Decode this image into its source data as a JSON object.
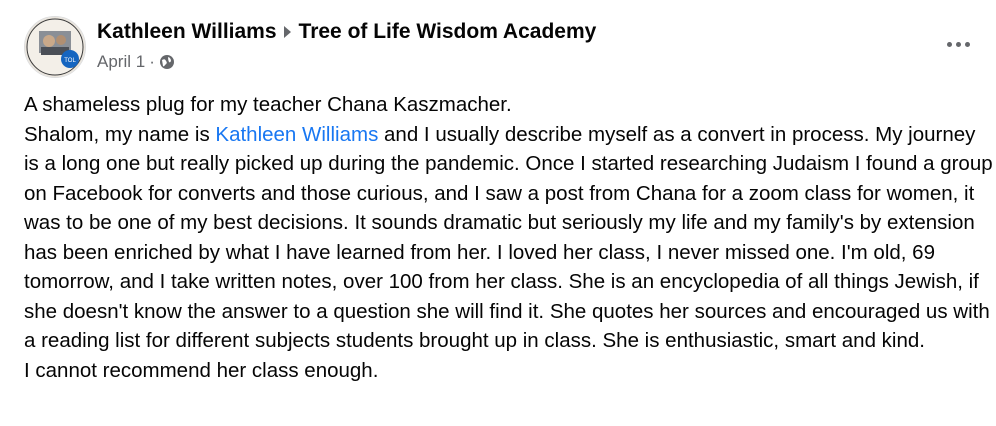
{
  "post": {
    "author": "Kathleen Williams",
    "group": "Tree of Life Wisdom Academy",
    "date": "April 1",
    "separator": "·",
    "privacy_icon": "globe-icon",
    "more_icon": "more-options-icon"
  },
  "body": {
    "line1": "A shameless plug for my teacher Chana Kaszmacher.",
    "para_intro": "Shalom, my name is ",
    "mention": "Kathleen Williams",
    "para_rest": " and I usually describe myself as a convert in process. My journey is a long one but really picked up during the pandemic. Once I started researching Judaism I found a group on Facebook for converts and those curious, and I saw a post from Chana for a zoom class for women, it was to be one of my best decisions. It sounds dramatic but seriously my life and my family's by extension has been enriched by what I have learned from her. I loved her class, I never missed one. I'm old, 69 tomorrow, and I take written notes, over 100 from her class. She is an encyclopedia of all things Jewish, if she doesn't know the answer to a question she will find it. She quotes her sources and encouraged us with a reading list for different subjects students brought up in class. She is enthusiastic, smart and kind.",
    "closing": "I cannot recommend her class enough."
  },
  "colors": {
    "text": "#050505",
    "secondary": "#65676b",
    "link": "#1877f2"
  }
}
